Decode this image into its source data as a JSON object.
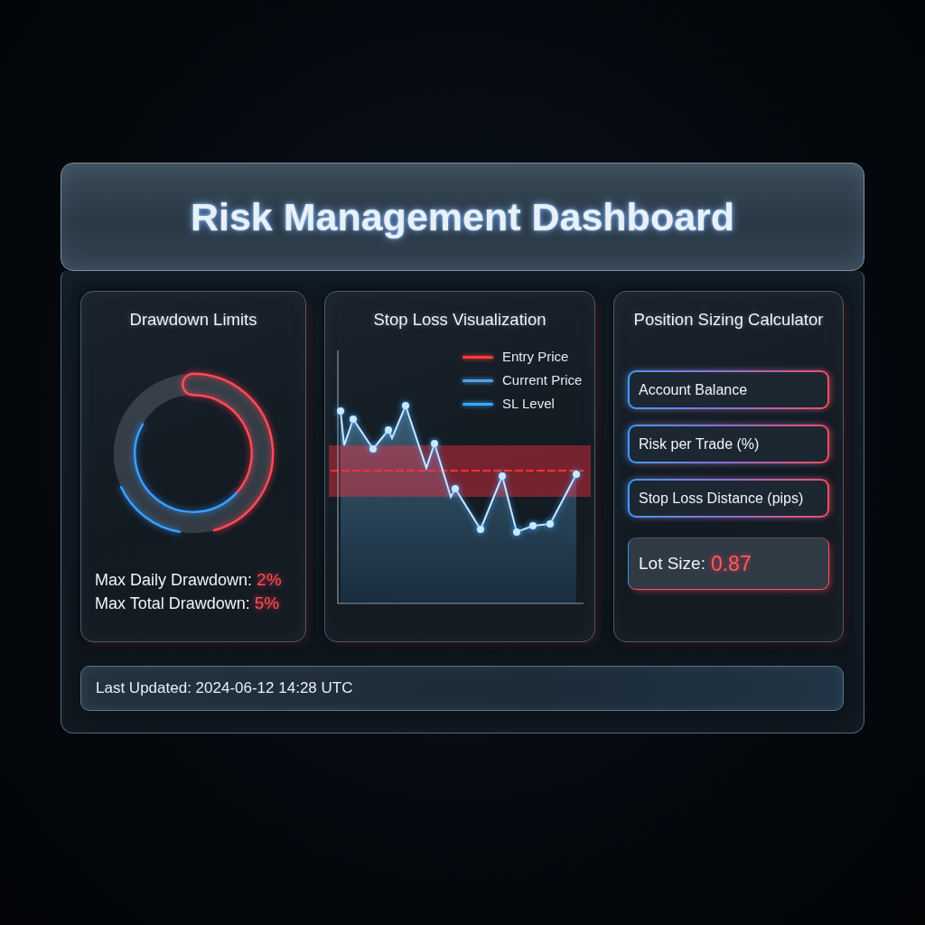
{
  "header": {
    "title": "Risk Management Dashboard"
  },
  "drawdown_limits": {
    "title": "Drawdown Limits",
    "limits": [
      {
        "label": "Max Daily Drawdown:",
        "value": "2%"
      },
      {
        "label": "Max Total Drawdown:",
        "value": "5%"
      }
    ]
  },
  "stop_loss_visualization": {
    "title": "Stop Loss Visualization",
    "legend": [
      {
        "label": "Entry Price",
        "color": "#ff3b3b"
      },
      {
        "label": "Current Price",
        "color": "#4fa3e8"
      },
      {
        "label": "SL Level",
        "color": "#39a6ff"
      }
    ]
  },
  "position_sizing_calculator": {
    "title": "Position Sizing Calculator",
    "fields": [
      {
        "placeholder": "Account Balance"
      },
      {
        "placeholder": "Risk per Trade (%)"
      },
      {
        "placeholder": "Stop Loss Distance (pips)"
      }
    ],
    "result": {
      "label": "Lot Size:",
      "value": "0.87"
    }
  },
  "status_bar": {
    "text": "Last Updated: 2024-06-12 14:28 UTC"
  }
}
